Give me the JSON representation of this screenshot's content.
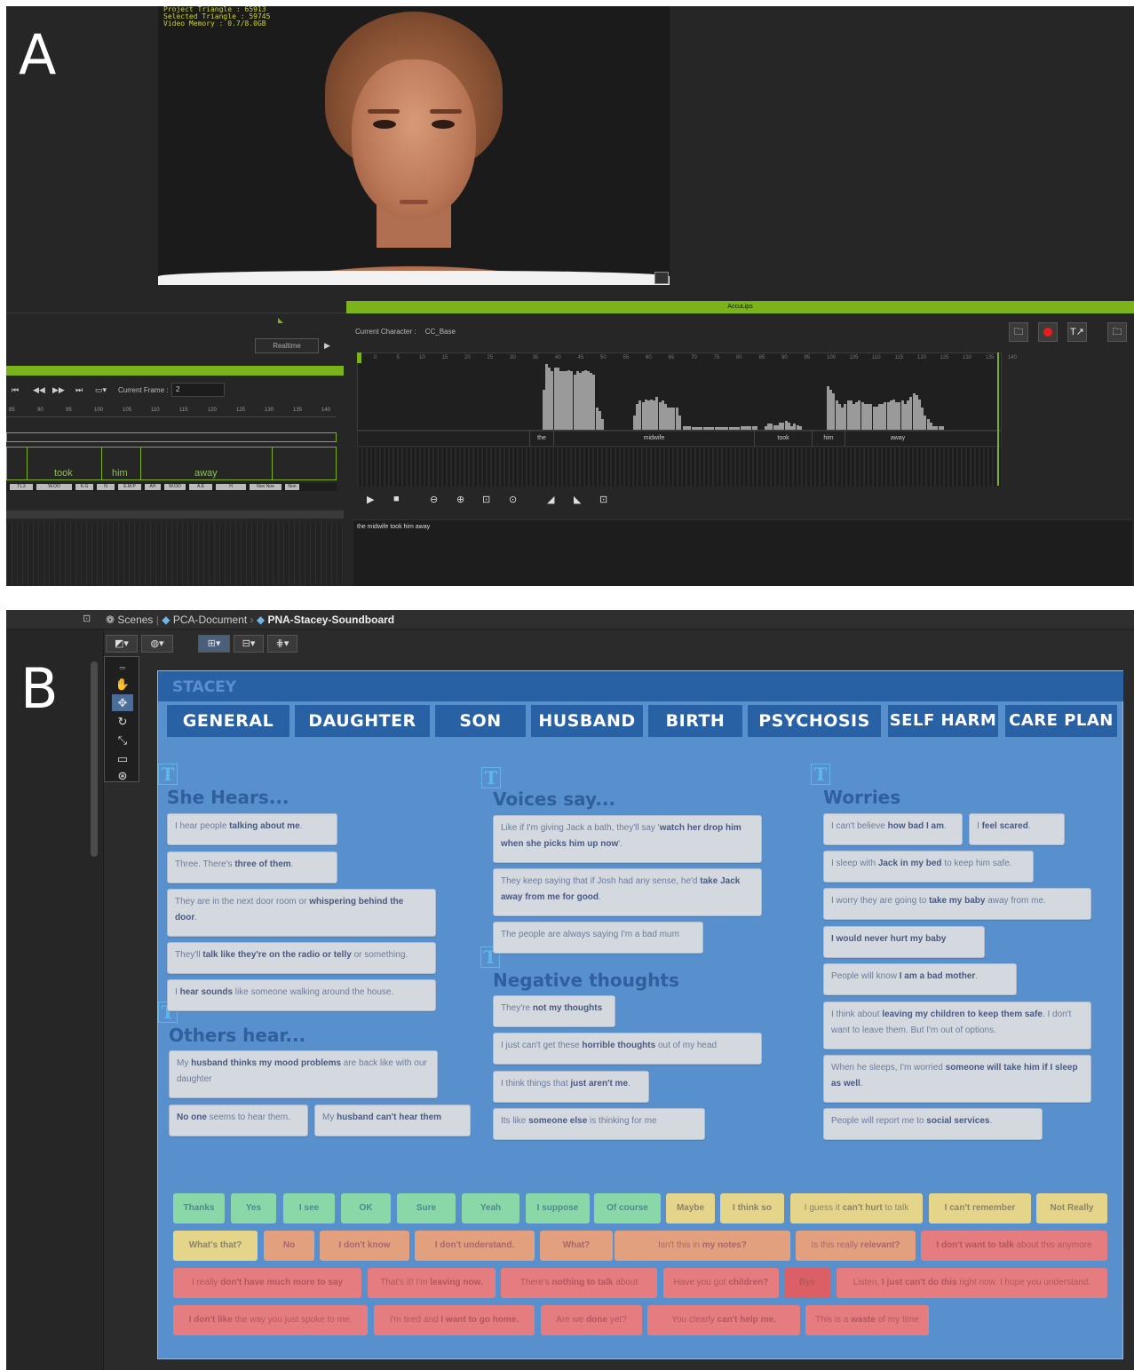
{
  "panelA": {
    "label": "A",
    "viewport_info": [
      "Project Triangle : 65913",
      "Selected Triangle : 59745",
      "Video Memory : 0.7/8.0GB"
    ],
    "realtime_label": "Realtime",
    "current_frame_label": "Current Frame :",
    "current_frame_value": "2",
    "ruler_left": [
      "85",
      "90",
      "95",
      "100",
      "105",
      "110",
      "115",
      "120",
      "125",
      "130",
      "135",
      "140"
    ],
    "words_left": [
      "took",
      "him",
      "away"
    ],
    "phonemes_left": [
      "T.L3",
      "W.OO",
      "K.G",
      "N",
      "E.M.P",
      "AH",
      "W.OO",
      "A.E",
      "H",
      "Non Noe",
      "Non"
    ],
    "acculips_title": "AccuLips",
    "current_character_label": "Current Character :",
    "current_character_value": "CC_Base",
    "ruler_right": [
      "0",
      "5",
      "10",
      "15",
      "20",
      "25",
      "30",
      "35",
      "40",
      "45",
      "50",
      "55",
      "60",
      "65",
      "70",
      "75",
      "80",
      "85",
      "90",
      "95",
      "100",
      "105",
      "110",
      "115",
      "120",
      "125",
      "130",
      "135",
      "140"
    ],
    "words_right": [
      "the",
      "midwife",
      "took",
      "him",
      "away"
    ],
    "text_value": "the midwife took him away",
    "colors": {
      "accent_green": "#7bb31a",
      "record_red": "#e81e1e"
    }
  },
  "panelB": {
    "label": "B",
    "breadcrumb": {
      "scenes": "Scenes",
      "doc": "PCA-Document",
      "board": "PNA-Stacey-Soundboard"
    },
    "title": "STACEY",
    "tabs": [
      "GENERAL",
      "DAUGHTER",
      "SON",
      "HUSBAND",
      "BIRTH",
      "PSYCHOSIS",
      "SELF HARM",
      "CARE PLAN"
    ],
    "sections": {
      "she_hears": "She Hears...",
      "others_hear": "Others hear...",
      "voices_say": "Voices say...",
      "negative": "Negative thoughts",
      "worries": "Worries"
    },
    "colors": {
      "board": "#5790cc",
      "header": "#2961a5",
      "green": "#8ad8a8",
      "yellow": "#e4d58b",
      "orange": "#e3a07e",
      "red": "#e47c80"
    }
  }
}
